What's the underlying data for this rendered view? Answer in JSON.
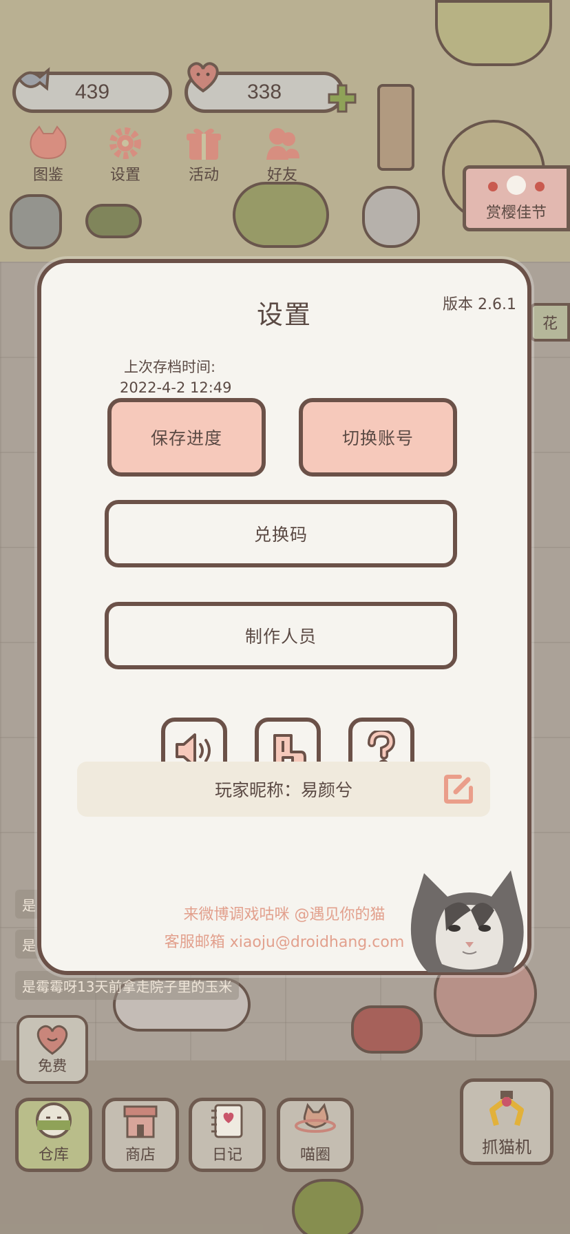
{
  "hud": {
    "fish_count": "439",
    "heart_count": "338",
    "buttons": [
      {
        "label": "图鉴",
        "icon": "cat-face-icon"
      },
      {
        "label": "设置",
        "icon": "gear-icon"
      },
      {
        "label": "活动",
        "icon": "gift-icon"
      },
      {
        "label": "好友",
        "icon": "friends-icon"
      }
    ],
    "event_label": "赏樱佳节",
    "side_label": "花"
  },
  "chat": {
    "line1": "是",
    "line2": "是",
    "line3": "是霉霉呀13天前拿走院子里的玉米"
  },
  "settings": {
    "title": "设置",
    "version": "版本 2.6.1",
    "last_save_label": "上次存档时间:",
    "last_save_time": "2022-4-2 12:49",
    "save_button": "保存进度",
    "switch_account_button": "切换账号",
    "redeem_code_button": "兑换码",
    "credits_button": "制作人员",
    "icons": [
      "sound-icon",
      "music-icon",
      "help-icon"
    ],
    "nickname_label": "玩家昵称：易颜兮",
    "weibo_line": "来微博调戏咕咪 @遇见你的猫",
    "email_line": "客服邮箱 xiaoju@droidhang.com"
  },
  "bottom_bar": {
    "free_label": "免费",
    "items": [
      {
        "label": "仓库",
        "icon": "storage-icon"
      },
      {
        "label": "商店",
        "icon": "shop-icon"
      },
      {
        "label": "日记",
        "icon": "diary-icon"
      },
      {
        "label": "喵圈",
        "icon": "cat-circle-icon"
      }
    ],
    "claw_label": "抓猫机"
  },
  "colors": {
    "modal_bg": "#f6f4ef",
    "border": "#6b5148",
    "pink_button": "#f6c9bb",
    "footer_text": "#e2a08d",
    "nickname_bg": "#f0eadd"
  }
}
